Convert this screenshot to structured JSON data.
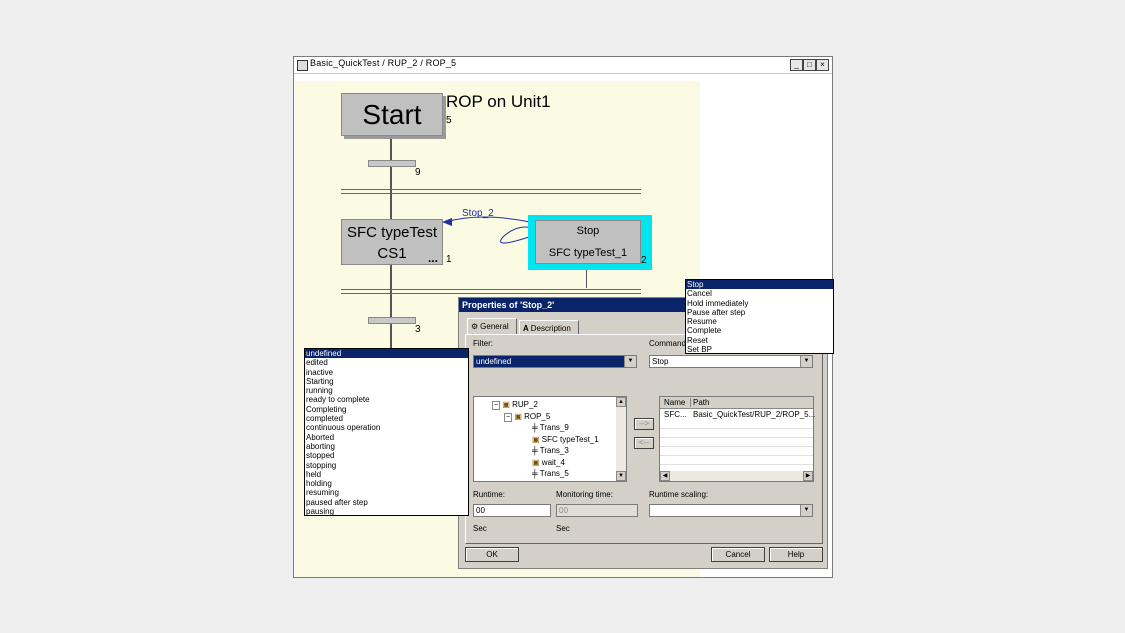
{
  "window": {
    "title": "Basic_QuickTest / RUP_2 / ROP_5",
    "min": "_",
    "max": "□",
    "close": "×"
  },
  "sfc": {
    "start_label": "Start",
    "start_num": "5",
    "rop_label": "ROP on Unit1",
    "trans_top_num": "9",
    "step1_line1": "SFC typeTest",
    "step1_line2": "CS1",
    "step1_dots": "...",
    "step1_num": "1",
    "link_label": "Stop_2",
    "stop_label": "Stop",
    "stop_sub": "SFC typeTest_1",
    "stop_num": "2",
    "trans_mid_num": "3"
  },
  "dialog": {
    "title": "Properties of 'Stop_2'",
    "tab_general": "General",
    "tab_description": "Description",
    "filter_label": "Filter:",
    "filter_value": "undefined",
    "command_label": "Command:",
    "command_value": "Stop",
    "tree": [
      {
        "text": "RUP_2",
        "expander": "−"
      },
      {
        "text": "ROP_5",
        "expander": "−"
      },
      {
        "text": "Trans_9",
        "expander": ""
      },
      {
        "text": "SFC typeTest_1",
        "expander": ""
      },
      {
        "text": "Trans_3",
        "expander": ""
      },
      {
        "text": "wait_4",
        "expander": ""
      },
      {
        "text": "Trans_5",
        "expander": ""
      }
    ],
    "move_right": "-->",
    "move_left": "<--",
    "col_name": "Name",
    "col_path": "Path",
    "row_name": "SFC...",
    "row_path": "Basic_QuickTest/RUP_2/ROP_5...",
    "runtime_label": "Runtime:",
    "runtime_value": "00",
    "runtime_unit": "Sec",
    "monitoring_label": "Monitoring time:",
    "monitoring_value": "00",
    "monitoring_unit": "Sec",
    "scaling_label": "Runtime scaling:",
    "scaling_value": "",
    "ok": "OK",
    "cancel": "Cancel",
    "help": "Help"
  },
  "filter_list": [
    "undefined",
    "edited",
    "inactive",
    "Starting",
    "running",
    "ready to complete",
    "Completing",
    "completed",
    "continuous operation",
    "Aborted",
    "aborting",
    "stopped",
    "stopping",
    "held",
    "holding",
    "resuming",
    "paused after step",
    "pausing"
  ],
  "command_list": [
    "Stop",
    "Cancel",
    "Hold immediately",
    "Pause after step",
    "Resume",
    "Complete",
    "Reset",
    "Set BP"
  ],
  "colors": {
    "selection": "#0a246a",
    "highlight": "#00e5f0",
    "canvas": "#fbfbe3"
  }
}
